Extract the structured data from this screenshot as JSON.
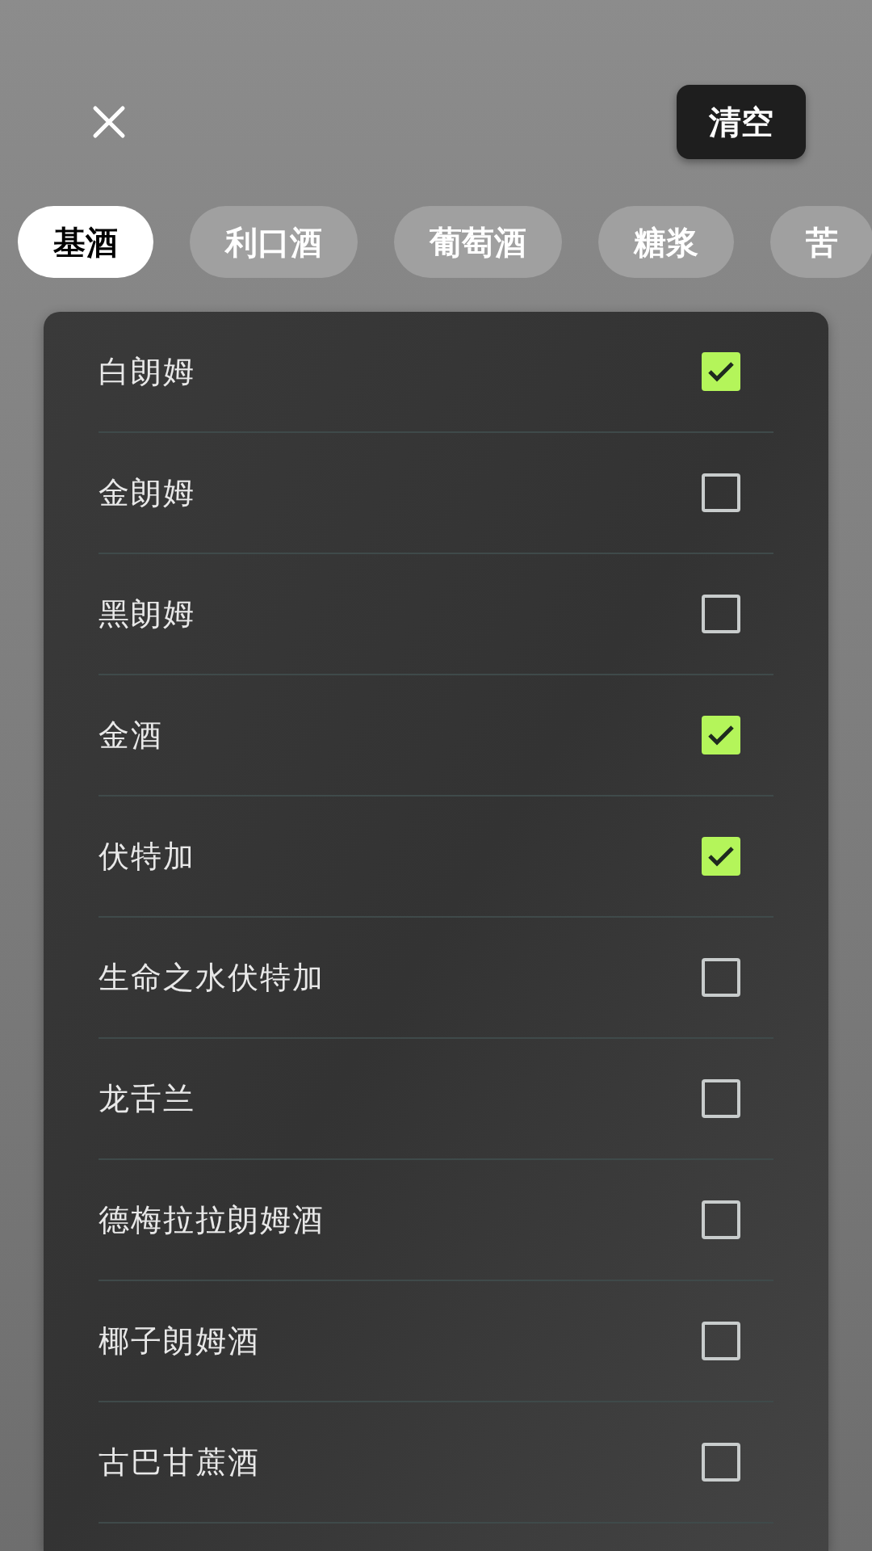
{
  "header": {
    "clear_button": "清空"
  },
  "tabs": [
    {
      "label": "基酒",
      "selected": true
    },
    {
      "label": "利口酒",
      "selected": false
    },
    {
      "label": "葡萄酒",
      "selected": false
    },
    {
      "label": "糖浆",
      "selected": false
    },
    {
      "label": "苦",
      "selected": false
    }
  ],
  "items": [
    {
      "name": "白朗姆",
      "checked": true
    },
    {
      "name": "金朗姆",
      "checked": false
    },
    {
      "name": "黑朗姆",
      "checked": false
    },
    {
      "name": "金酒",
      "checked": true
    },
    {
      "name": "伏特加",
      "checked": true
    },
    {
      "name": "生命之水伏特加",
      "checked": false
    },
    {
      "name": "龙舌兰",
      "checked": false
    },
    {
      "name": "德梅拉拉朗姆酒",
      "checked": false
    },
    {
      "name": "椰子朗姆酒",
      "checked": false
    },
    {
      "name": "古巴甘蔗酒",
      "checked": false
    }
  ]
}
